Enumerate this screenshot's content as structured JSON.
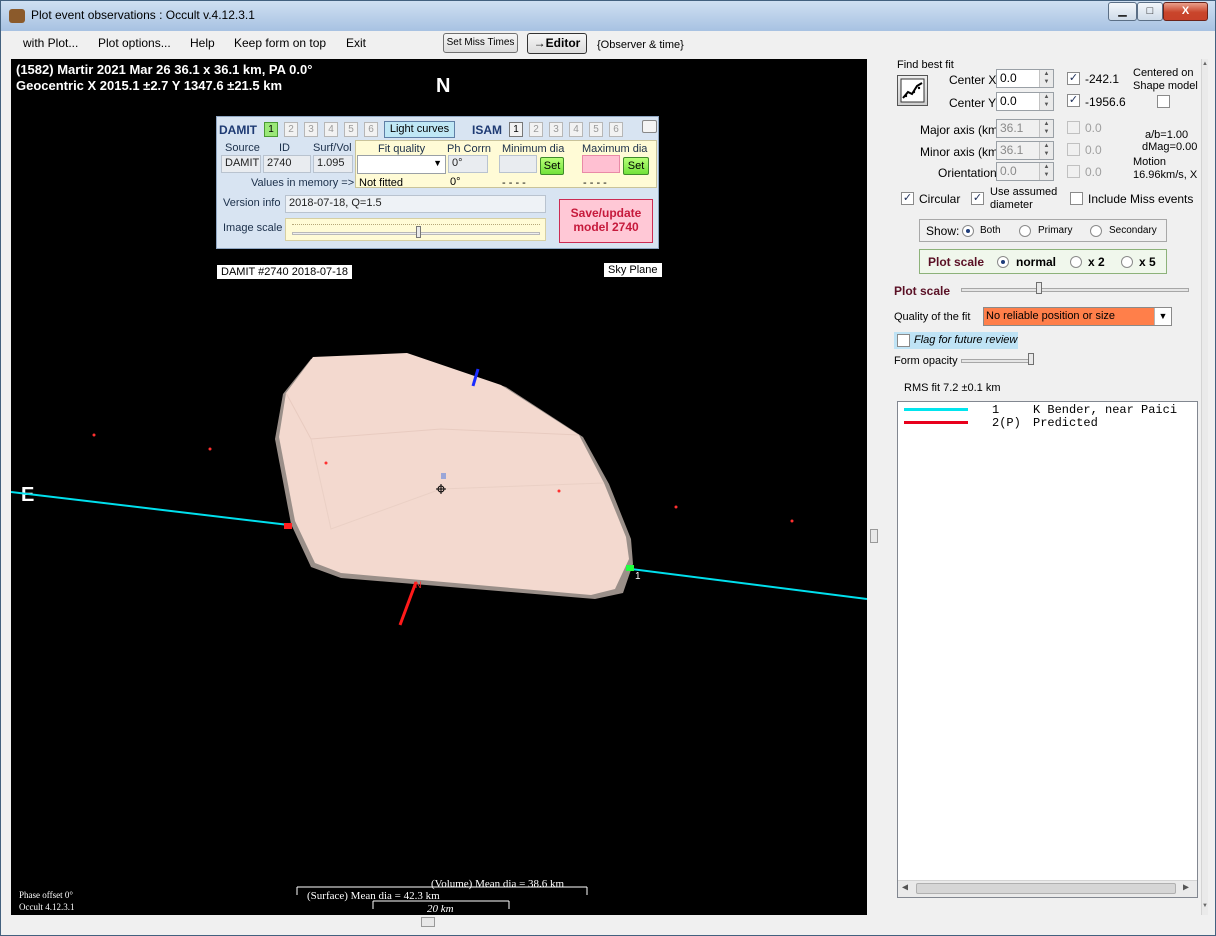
{
  "window": {
    "title": "Plot event observations : Occult v.4.12.3.1",
    "controls": {
      "minimize": "▁",
      "maximize": "□",
      "close": "X"
    }
  },
  "menu": {
    "with_plot": "with Plot...",
    "plot_options": "Plot options...",
    "help": "Help",
    "keep_on_top": "Keep form on top",
    "exit": "Exit",
    "set_miss_times": "Set Miss Times",
    "editor": "→Editor",
    "observer_time": "{Observer & time}"
  },
  "plot": {
    "header_line1": "(1582) Martir  2021 Mar 26   36.1 x 36.1 km, PA 0.0°",
    "header_line2": "Geocentric  X  2015.1 ±2.7  Y 1347.6 ±21.5 km",
    "north": "N",
    "east": "E",
    "chord_label": "1",
    "damit_tag": "DAMIT #2740 2018-07-18",
    "sky_plane": "Sky Plane",
    "volume_dia": "(Volume) Mean dia = 38.6 km",
    "surface_dia": "(Surface) Mean dia = 42.3 km",
    "scale_bar": "20 km",
    "phase_offset": "Phase offset 0°",
    "version": "Occult 4.12.3.1"
  },
  "damit_panel": {
    "damit": "DAMIT",
    "damit_tabs": [
      "1",
      "2",
      "3",
      "4",
      "5",
      "6"
    ],
    "light_curves": "Light curves",
    "isam": "ISAM",
    "isam_tabs": [
      "1",
      "2",
      "3",
      "4",
      "5",
      "6"
    ],
    "col_source": "Source",
    "col_id": "ID",
    "col_surfvol": "Surf/Vol",
    "col_fit_quality": "Fit quality",
    "col_ph_corr": "Ph Corrn",
    "col_min_dia": "Minimum dia",
    "col_max_dia": "Maximum dia",
    "source_value": "DAMIT",
    "id_value": "2740",
    "surfvol_value": "1.095",
    "ph_corr_value": "0°",
    "set": "Set",
    "values_in_memory": "Values in memory =>",
    "not_fitted": "Not fitted",
    "ph_mem": "0°",
    "min_mem": "- - - -",
    "max_mem": "- - - -",
    "version_info_label": "Version info",
    "version_info_value": "2018-07-18, Q=1.5",
    "image_scale_label": "Image scale",
    "save_update": "Save/update",
    "model_2740": "model 2740"
  },
  "right": {
    "find_best_fit": "Find best fit",
    "center_x_label": "Center X",
    "center_x_value": "0.0",
    "center_x_result": "-242.1",
    "center_y_label": "Center Y",
    "center_y_value": "0.0",
    "center_y_result": "-1956.6",
    "centered_on": "Centered on",
    "shape_model": "Shape model",
    "major_axis_label": "Major axis (km)",
    "major_axis_value": "36.1",
    "major_axis_result": "0.0",
    "minor_axis_label": "Minor axis (km)",
    "minor_axis_value": "36.1",
    "minor_axis_result": "0.0",
    "orientation_label": "Orientation",
    "orientation_value": "0.0",
    "orientation_result": "0.0",
    "ab": "a/b=1.00",
    "dmag": "dMag=0.00",
    "motion": "Motion",
    "motion_value": "16.96km/s, X",
    "circular": "Circular",
    "use_assumed": "Use assumed",
    "diameter": "diameter",
    "include_miss": "Include Miss events",
    "show_label": "Show:",
    "show_both": "Both",
    "show_primary": "Primary",
    "show_secondary": "Secondary",
    "plot_scale_group": "Plot scale",
    "scale_normal": "normal",
    "scale_x2": "x 2",
    "scale_x5": "x 5",
    "plot_scale": "Plot scale",
    "quality_label": "Quality of the fit",
    "quality_value": "No reliable position or size",
    "flag_review": "Flag for future review",
    "form_opacity": "Form opacity",
    "rms_fit": "RMS fit 7.2 ±0.1 km",
    "list": [
      {
        "num": "1",
        "text": "K Bender, near Paici",
        "color": "#00e5ee"
      },
      {
        "num": "2(P)",
        "text": "Predicted",
        "color": "#e8001c"
      }
    ]
  }
}
